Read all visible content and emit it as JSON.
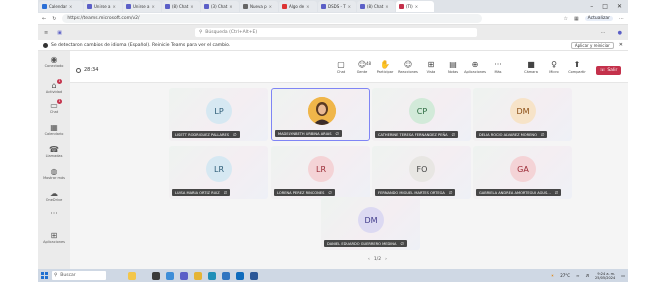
{
  "browser": {
    "tabs": [
      {
        "label": "Calendar",
        "color": "#2b6fd6"
      },
      {
        "label": "Unirse a",
        "color": "#5b5fc7"
      },
      {
        "label": "Unirse a",
        "color": "#5b5fc7"
      },
      {
        "label": "(8) Chat",
        "color": "#5b5fc7"
      },
      {
        "label": "(3) Chat",
        "color": "#5b5fc7"
      },
      {
        "label": "Nueva p",
        "color": "#666"
      },
      {
        "label": "Algo de",
        "color": "#d33"
      },
      {
        "label": "DSDS - T",
        "color": "#5b5fc7"
      },
      {
        "label": "(8) Chat",
        "color": "#5b5fc7"
      },
      {
        "label": "(TI)",
        "color": "#c4314b"
      }
    ],
    "url": "https://teams.microsoft.com/v2/",
    "update_label": "Actualizar"
  },
  "teams": {
    "search_placeholder": "Búsqueda (Ctrl+Alt+E)"
  },
  "banner": {
    "message": "Se detectaron cambios de idioma (Español). Reinicie Teams para ver el cambio.",
    "button_label": "Aplicar y reiniciar"
  },
  "rail": [
    {
      "label": "Conectado",
      "icon": "people-icon",
      "glyph": "◉",
      "badge": ""
    },
    {
      "label": "Actividad",
      "icon": "bell-icon",
      "glyph": "⌂",
      "badge": "1"
    },
    {
      "label": "Chat",
      "icon": "chat-icon",
      "glyph": "▭",
      "badge": "1"
    },
    {
      "label": "Calendario",
      "icon": "calendar-icon",
      "glyph": "▦",
      "badge": ""
    },
    {
      "label": "Llamadas",
      "icon": "phone-icon",
      "glyph": "☎",
      "badge": ""
    },
    {
      "label": "Mostrar más",
      "icon": "more-icon",
      "glyph": "◍",
      "badge": ""
    },
    {
      "label": "OneDrive",
      "icon": "cloud-icon",
      "glyph": "☁",
      "badge": ""
    },
    {
      "label": "",
      "icon": "ellipsis-icon",
      "glyph": "···",
      "badge": ""
    },
    {
      "label": "Aplicaciones",
      "icon": "apps-icon",
      "glyph": "⊞",
      "badge": ""
    }
  ],
  "meeting": {
    "timer": "28:34",
    "controls": [
      {
        "label": "Chat",
        "icon": "chat-icon",
        "glyph": "▢"
      },
      {
        "label": "Gente",
        "icon": "people-icon",
        "glyph": "☺",
        "count": "48"
      },
      {
        "label": "Participar",
        "icon": "hand-icon",
        "glyph": "✋"
      },
      {
        "label": "Reacciones",
        "icon": "emoji-icon",
        "glyph": "☺"
      },
      {
        "label": "Vista",
        "icon": "grid-icon",
        "glyph": "⊞"
      },
      {
        "label": "Notas",
        "icon": "notes-icon",
        "glyph": "▤"
      },
      {
        "label": "Aplicaciones",
        "icon": "apps-icon",
        "glyph": "⊕"
      },
      {
        "label": "Más",
        "icon": "more-icon",
        "glyph": "···"
      },
      {
        "label": "Cámara",
        "icon": "camera-icon",
        "glyph": "■"
      },
      {
        "label": "Micro",
        "icon": "mic-icon",
        "glyph": "♀"
      },
      {
        "label": "Compartir",
        "icon": "share-icon",
        "glyph": "⬆"
      }
    ],
    "leave_label": "Salir"
  },
  "participants": [
    {
      "initials": "LP",
      "name": "LISETT RODRIGUEZ PALLARES",
      "avatar_bg": "#d6e8f2",
      "avatar_fg": "#2e5e78",
      "speaking": false,
      "photo": false
    },
    {
      "initials": "",
      "name": "MADELYNBETH URBINA ARIAS",
      "avatar_bg": "#f0b64a",
      "avatar_fg": "#000",
      "speaking": true,
      "photo": true
    },
    {
      "initials": "CP",
      "name": "CATHERINE TERESA FERNANDEZ PEÑA",
      "avatar_bg": "#d2ead9",
      "avatar_fg": "#2b6a3f",
      "speaking": false,
      "photo": false
    },
    {
      "initials": "DM",
      "name": "DELIA ROCIO ALVAREZ MORENO",
      "avatar_bg": "#f7e3c8",
      "avatar_fg": "#8a4b12",
      "speaking": false,
      "photo": false
    },
    {
      "initials": "LR",
      "name": "LUISA MARIA ORTIZ RUIZ",
      "avatar_bg": "#d6e8f2",
      "avatar_fg": "#2e5e78",
      "speaking": false,
      "photo": false
    },
    {
      "initials": "LR",
      "name": "LORENA PEREZ RINCONES",
      "avatar_bg": "#f4d3d6",
      "avatar_fg": "#9b2a35",
      "speaking": false,
      "photo": false
    },
    {
      "initials": "FO",
      "name": "FERNANDO MIGUEL MARTES ORTEGA",
      "avatar_bg": "#e8e6e3",
      "avatar_fg": "#444",
      "speaking": false,
      "photo": false
    },
    {
      "initials": "GA",
      "name": "GABRIELA ANDREA AMORTEGUI AGUS...",
      "avatar_bg": "#f4d3d6",
      "avatar_fg": "#9b2a35",
      "speaking": false,
      "photo": false
    },
    {
      "initials": "DM",
      "name": "DANIEL EDUARDO GUERRERO MEDINA",
      "avatar_bg": "#dcd9f2",
      "avatar_fg": "#3f3a8a",
      "speaking": false,
      "photo": false
    }
  ],
  "pager": "1/2",
  "taskbar": {
    "search_placeholder": "Buscar",
    "weather": "27°C",
    "time": "9:24 a. m.",
    "date": "25/05/2024"
  }
}
